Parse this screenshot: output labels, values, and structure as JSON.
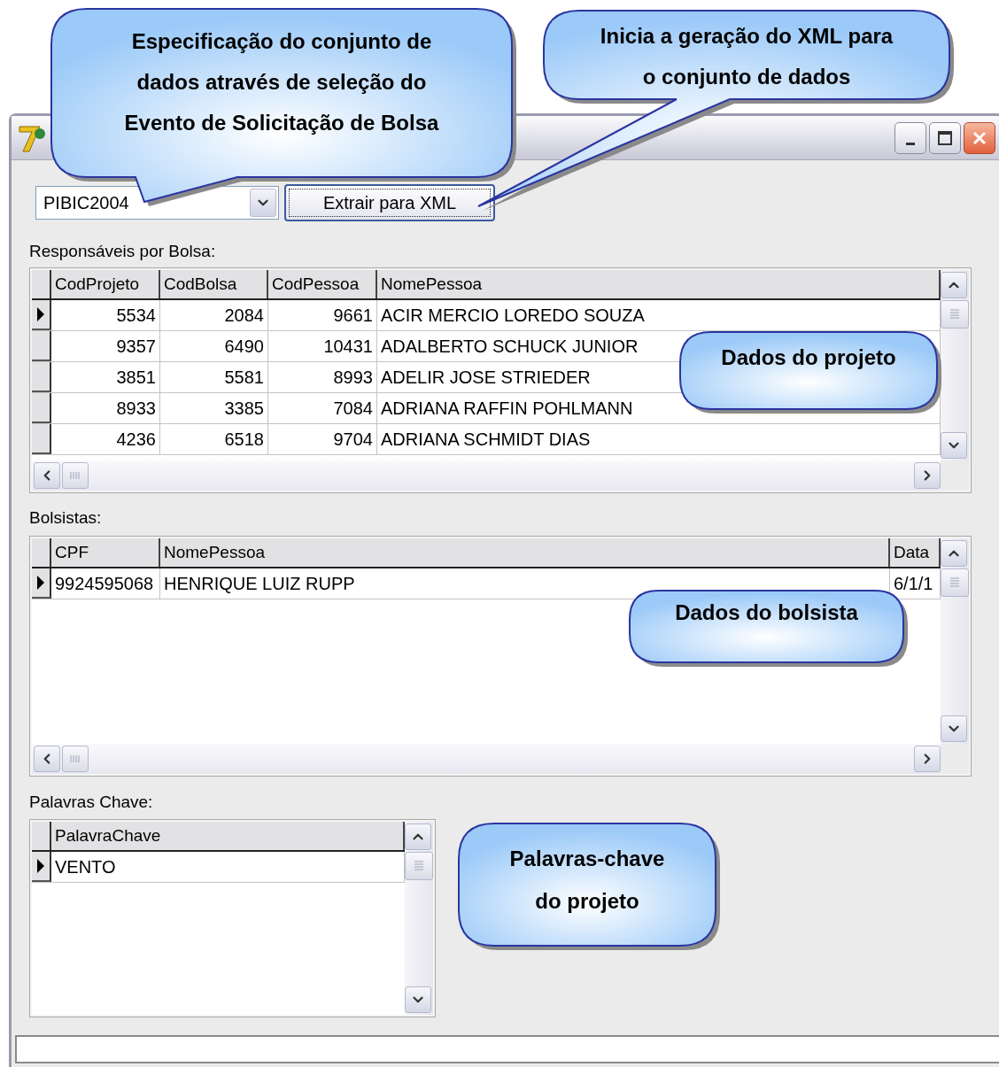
{
  "window": {
    "combo": {
      "value": "PIBIC2004"
    },
    "extract_button": "Extrair para XML",
    "grids": [
      {
        "label": "Responsáveis por Bolsa:",
        "columns": [
          "CodProjeto",
          "CodBolsa",
          "CodPessoa",
          "NomePessoa"
        ],
        "rows": [
          {
            "cells": [
              "5534",
              "2084",
              "9661",
              "ACIR MERCIO LOREDO SOUZA"
            ],
            "selected": true
          },
          {
            "cells": [
              "9357",
              "6490",
              "10431",
              "ADALBERTO SCHUCK JUNIOR"
            ],
            "selected": false
          },
          {
            "cells": [
              "3851",
              "5581",
              "8993",
              "ADELIR JOSE STRIEDER"
            ],
            "selected": false
          },
          {
            "cells": [
              "8933",
              "3385",
              "7084",
              "ADRIANA RAFFIN POHLMANN"
            ],
            "selected": false
          },
          {
            "cells": [
              "4236",
              "6518",
              "9704",
              "ADRIANA SCHMIDT DIAS"
            ],
            "selected": false
          }
        ]
      },
      {
        "label": "Bolsistas:",
        "columns": [
          "CPF",
          "NomePessoa",
          "Data"
        ],
        "rows": [
          {
            "cells": [
              "9924595068",
              "HENRIQUE LUIZ RUPP",
              "6/1/1"
            ],
            "selected": true
          }
        ]
      },
      {
        "label": "Palavras Chave:",
        "columns": [
          "PalavraChave"
        ],
        "rows": [
          {
            "cells": [
              "VENTO"
            ],
            "selected": true
          }
        ]
      }
    ]
  },
  "callouts": [
    {
      "lines": [
        "Especificação do conjunto de",
        "dados através de seleção do",
        "Evento de Solicitação de Bolsa"
      ]
    },
    {
      "lines": [
        "Inicia a geração do XML para",
        "o conjunto de dados"
      ]
    },
    {
      "lines": [
        "Dados do projeto"
      ]
    },
    {
      "lines": [
        "Dados do bolsista"
      ]
    },
    {
      "lines": [
        "Palavras-chave",
        "do projeto"
      ]
    }
  ]
}
